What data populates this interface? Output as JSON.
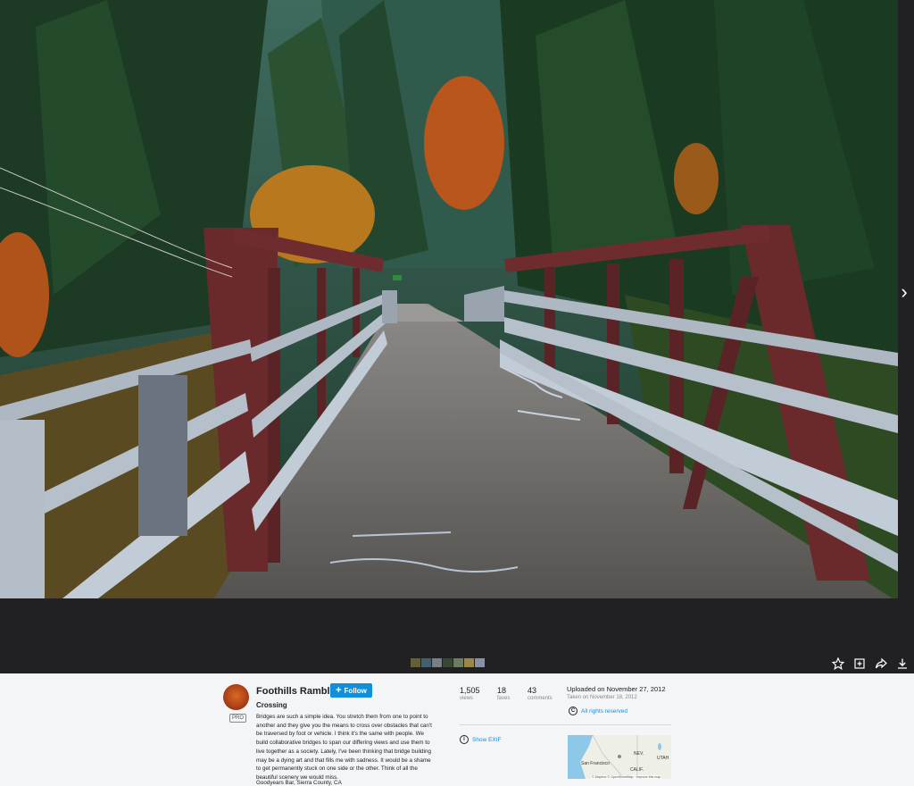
{
  "viewer": {
    "next_arrow": "›",
    "filmstrip_colors": [
      "#6e6a3a",
      "#4a6a7a",
      "#8a8f96",
      "#3d4f3a",
      "#7a8b6a",
      "#b09a50",
      "#9aa6b8"
    ],
    "actions": [
      "star-icon",
      "add-to-gallery-icon",
      "share-icon",
      "download-icon"
    ]
  },
  "author": {
    "name": "Foothills Rambler",
    "badge": "PRO",
    "follow_label": "Follow"
  },
  "photo": {
    "title": "Crossing",
    "description": "Bridges are such a simple idea. You stretch them from one to point to another and they give you the means to cross over obstacles that can't be traversed by foot or vehicle. I think it's the same with people. We build collaborative bridges to span our differing views and use them to live together as a society. Lately, I've been thinking that bridge building may be a dying art and that fills me with sadness. It would be a shame to get permanently stuck on one side or the other. Think of all the beautiful scenery we would miss.",
    "location": "Goodyears Bar, Sierra County, CA"
  },
  "stats": {
    "views": "1,505",
    "views_label": "views",
    "faves": "18",
    "faves_label": "faves",
    "comments": "43",
    "comments_label": "comments"
  },
  "meta": {
    "uploaded": "Uploaded on November 27, 2012",
    "taken": "Taken on November 18, 2012",
    "rights": "All rights reserved",
    "show_exif": "Show EXIF"
  },
  "map": {
    "labels": [
      "NEV.",
      "UTAH",
      "San Francisco",
      "CALIF."
    ],
    "attribution": "© Mapbox © OpenStreetMap · Improve this map"
  },
  "colors": {
    "accent": "#128fdc",
    "viewer_bg": "#212124",
    "page_bg": "#f3f5f6"
  }
}
